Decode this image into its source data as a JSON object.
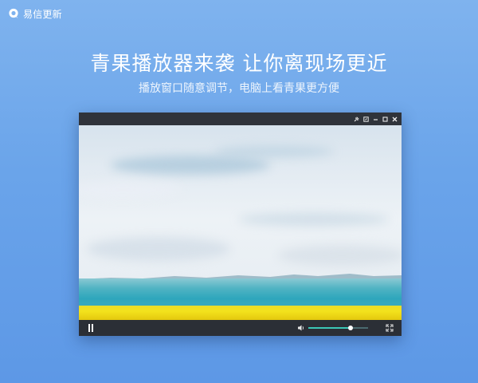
{
  "app": {
    "title": "易信更新",
    "icon": "yixin-logo-icon"
  },
  "hero": {
    "headline": "青果播放器来袭 让你离现场更近",
    "subline": "播放窗口随意调节，电脑上看青果更方便"
  },
  "player": {
    "title_bar_icons": [
      "pin-icon",
      "restore-icon",
      "minimize-icon",
      "maximize-icon",
      "close-icon"
    ],
    "state": "playing",
    "pause_icon": "pause-icon",
    "volume_icon": "volume-icon",
    "volume_level": 0.71,
    "fullscreen_icon": "fullscreen-icon",
    "accent_color": "#3cc7b6"
  },
  "colors": {
    "background_top": "#7fb3ee",
    "background_bottom": "#5d98e6",
    "player_chrome": "#2b2f36"
  }
}
